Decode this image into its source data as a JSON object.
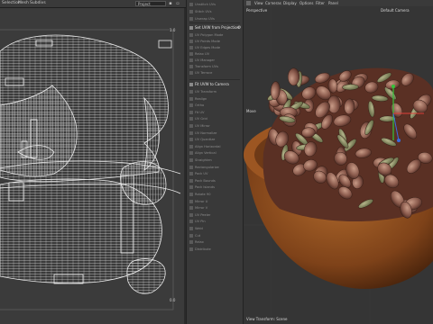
{
  "menubar": {
    "items": [
      "Selection",
      "Mesh",
      "Subdivs"
    ],
    "dropdown_value": "Project"
  },
  "uv_editor": {
    "corner_label_top": "1.0",
    "corner_label_bottom": "0.0",
    "edge_color": "#e8e8e8",
    "background_color": "#3b3b3b"
  },
  "tools": {
    "top_rows": [
      "Unstitch UVs",
      "Stitch UVs",
      "Unwrap UVs"
    ],
    "projection_header": "Set UVW from Projection",
    "projection_rows": [
      "UV Polygon Mode",
      "UV Points Mode",
      "UV Edges Mode",
      "Relax UV",
      "UV Manager",
      "Transform UVs",
      "UV Terrace"
    ],
    "camera_header": "Fit UVW to Camera",
    "camera_rows": [
      "UV Transform",
      "Realign",
      "Ortho",
      "Fit UV",
      "UV Grid",
      "UV Mirror",
      "UV Normalize",
      "UV Quantize",
      "Align Horizontal",
      "Align Vertical",
      "Straighten",
      "Rectangularize",
      "Pack UV",
      "Pack Bounds",
      "Pack Islands",
      "Rotate 90",
      "Mirror U",
      "Mirror V",
      "UV Peeler",
      "UV Pin",
      "Weld",
      "Cut",
      "Relax",
      "Distribute"
    ],
    "accent_color": "#e4e4e4"
  },
  "viewport": {
    "menu": [
      "View",
      "Cameras",
      "Display",
      "Options",
      "Filter",
      "Panel"
    ],
    "view_name": "Perspective",
    "camera_name": "Default Camera",
    "status_text": "View Transform: Scene",
    "move_label": "Move",
    "axis_colors": {
      "x": "#e0403a",
      "y": "#35c23a",
      "z": "#3a6de0"
    },
    "bowl_color": "#8a4a1e"
  }
}
